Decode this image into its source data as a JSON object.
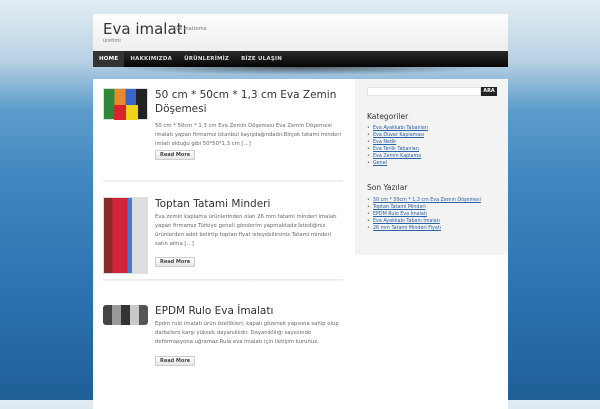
{
  "header": {
    "title": "Eva imalatı",
    "tagline_1": "Eva malzeme",
    "tagline_2": "üretimi"
  },
  "nav": [
    "HOME",
    "HAKKIMIZDA",
    "ÜRÜNLERİMİZ",
    "BİZE ULAŞIN"
  ],
  "posts": [
    {
      "title": "50 cm * 50cm * 1,3 cm Eva Zemin Döşemesi",
      "excerpt": "50 cm * 50cm * 1,3 cm Eva Zemin Döşemesi Eva Zemin Döşemesi imalatı yapan firmamız istanbul kayışdağındadır.Birçok tatami minderi imlatı olduğu gibi 50*50*1,3 cm […]",
      "read_more": "Read More"
    },
    {
      "title": "Toptan Tatami Minderi",
      "excerpt": "Eva zemin kaplama ürünlerinden olan 26 mm tatami minderi imalatı yapan firmamız Türkiye geneli gönderim yapmaktadır.İstediğiniz ürünlerden adet belirtip toptan fiyat isteyebilirsiniz.Tatami minderi satın alma […]",
      "read_more": "Read More"
    },
    {
      "title": "EPDM Rulo Eva İmalatı",
      "excerpt": "Epdm rulo imalatı ürün özellikleri; kapalı gözenek yapısına sahip olup darbelere karşı yüksek dayanıklıdır. Dayanıklılığı sayesinde deformasyona uğramaz.Rula eva imalatı için iletişim kurunuz.",
      "read_more": "Read More"
    }
  ],
  "sidebar": {
    "search_button": "ARA",
    "categories_title": "Kategoriler",
    "categories": [
      "Eva Ayakkabı Tabanları",
      "Eva Duvar Kaplaması",
      "Eva Nedir",
      "Eva Terlik Tabanları",
      "Eva Zemin Kaplama",
      "Genel"
    ],
    "recent_title": "Son Yazılar",
    "recent": [
      "50 cm * 50cm * 1,3 cm Eva Zemin Döşemesi",
      "Toptan Tatami Minderi",
      "EPDM Rulo Eva İmalatı",
      "Eva Ayakkabı Tabanı İmalatı",
      "26 mm Tatami Minderi Fiyatı"
    ]
  }
}
